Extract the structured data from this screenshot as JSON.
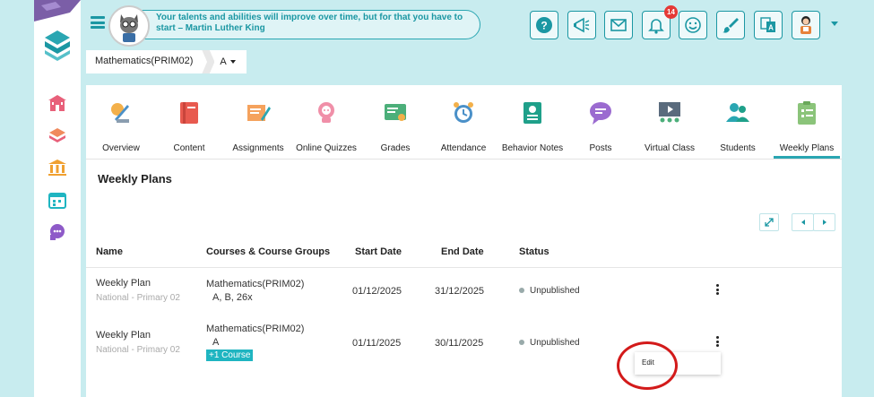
{
  "header": {
    "quote": "Your talents and abilities will improve over time, but for that you have to start – Martin Luther King",
    "notification_count": "14",
    "icons": [
      "help-icon",
      "megaphone-icon",
      "mail-icon",
      "bell-icon",
      "smiley-icon",
      "paintbrush-icon",
      "language-icon",
      "teacher-avatar-icon"
    ]
  },
  "breadcrumb": {
    "course": "Mathematics(PRIM02)",
    "section": "A"
  },
  "nav": {
    "tabs": [
      {
        "label": "Overview",
        "icon": "overview-icon"
      },
      {
        "label": "Content",
        "icon": "book-icon"
      },
      {
        "label": "Assignments",
        "icon": "assignment-icon"
      },
      {
        "label": "Online Quizzes",
        "icon": "quiz-icon"
      },
      {
        "label": "Grades",
        "icon": "grades-icon"
      },
      {
        "label": "Attendance",
        "icon": "alarm-icon"
      },
      {
        "label": "Behavior Notes",
        "icon": "behavior-icon"
      },
      {
        "label": "Posts",
        "icon": "posts-icon"
      },
      {
        "label": "Virtual Class",
        "icon": "virtual-class-icon"
      },
      {
        "label": "Students",
        "icon": "students-icon"
      },
      {
        "label": "Weekly Plans",
        "icon": "weekly-plans-icon"
      }
    ],
    "active": "Weekly Plans"
  },
  "page": {
    "title": "Weekly Plans"
  },
  "table": {
    "headers": [
      "Name",
      "Courses & Course Groups",
      "Start Date",
      "End Date",
      "Status"
    ],
    "rows": [
      {
        "name": "Weekly Plan",
        "sub": "National - Primary 02",
        "course": "Mathematics(PRIM02)",
        "groups": "A, B, 26x",
        "extra": "",
        "start": "01/12/2025",
        "end": "31/12/2025",
        "status": "Unpublished"
      },
      {
        "name": "Weekly Plan",
        "sub": "National - Primary 02",
        "course": "Mathematics(PRIM02)",
        "groups": "A",
        "extra": "+1 Course",
        "start": "01/11/2025",
        "end": "30/11/2025",
        "status": "Unpublished"
      }
    ]
  },
  "context_menu": {
    "edit_label": "Edit"
  },
  "colors": {
    "accent": "#1b97a3",
    "badge": "#e53935",
    "highlight_ring": "#d31a1a",
    "background": "#c8ecef"
  }
}
